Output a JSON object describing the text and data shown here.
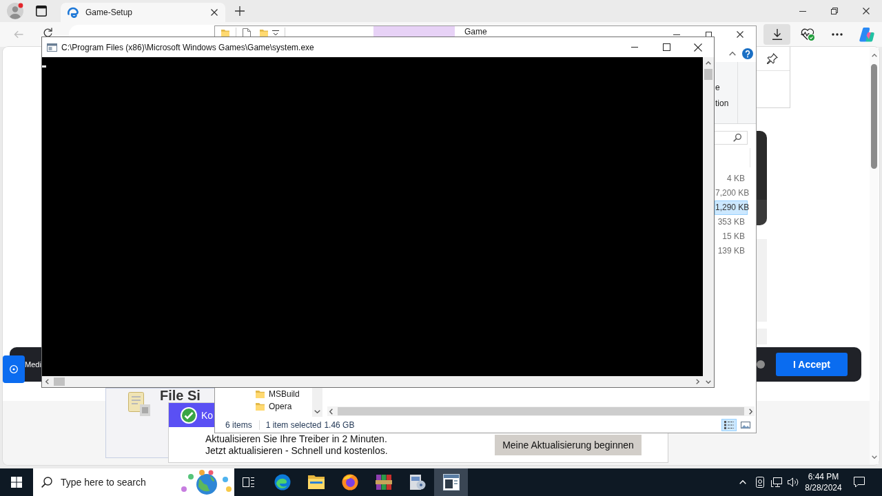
{
  "browser": {
    "tabs": [
      {
        "title": "Game-Setup",
        "selected": true
      }
    ],
    "toolbar": {
      "back_disabled": true,
      "downloads_open": true
    }
  },
  "page": {
    "banner": {
      "text": "Medi",
      "button": "I Accept"
    },
    "card": {
      "title": "File Si"
    }
  },
  "explorer": {
    "title": "Game",
    "ribbon_labels": [
      "e",
      "tion"
    ],
    "files": [
      {
        "size": "4 KB",
        "selected": false
      },
      {
        "size": "7,200 KB",
        "selected": false
      },
      {
        "size": "1,290 KB",
        "selected": true
      },
      {
        "size": "353 KB",
        "selected": false
      },
      {
        "size": "15 KB",
        "selected": false
      },
      {
        "size": "139 KB",
        "selected": false
      }
    ],
    "folders": [
      "MSBuild",
      "Opera"
    ],
    "status": {
      "items": "6 items",
      "selection": "1 item selected",
      "size": "1.46 GB"
    },
    "views": [
      {
        "kind": "details",
        "selected": true
      },
      {
        "kind": "thumbnails",
        "selected": false
      }
    ]
  },
  "popup": {
    "title": "Ko",
    "lines": [
      "Aktualisieren Sie Ihre Treiber in 2 Minuten.",
      "Jetzt aktualisieren - Schnell und kostenlos."
    ],
    "button": "Meine Aktualisierung beginnen"
  },
  "console": {
    "title": "C:\\Program Files (x86)\\Microsoft Windows Games\\Game\\system.exe"
  },
  "taskbar": {
    "search": {
      "placeholder": "Type here to search"
    },
    "apps": [
      {
        "kind": "browser",
        "active": false
      },
      {
        "kind": "folder",
        "active": false
      },
      {
        "kind": "firefox",
        "active": false
      },
      {
        "kind": "archive",
        "active": false
      },
      {
        "kind": "installer",
        "active": false
      },
      {
        "kind": "console",
        "active": true
      }
    ],
    "time": "6:44 PM",
    "date": "8/28/2024"
  }
}
